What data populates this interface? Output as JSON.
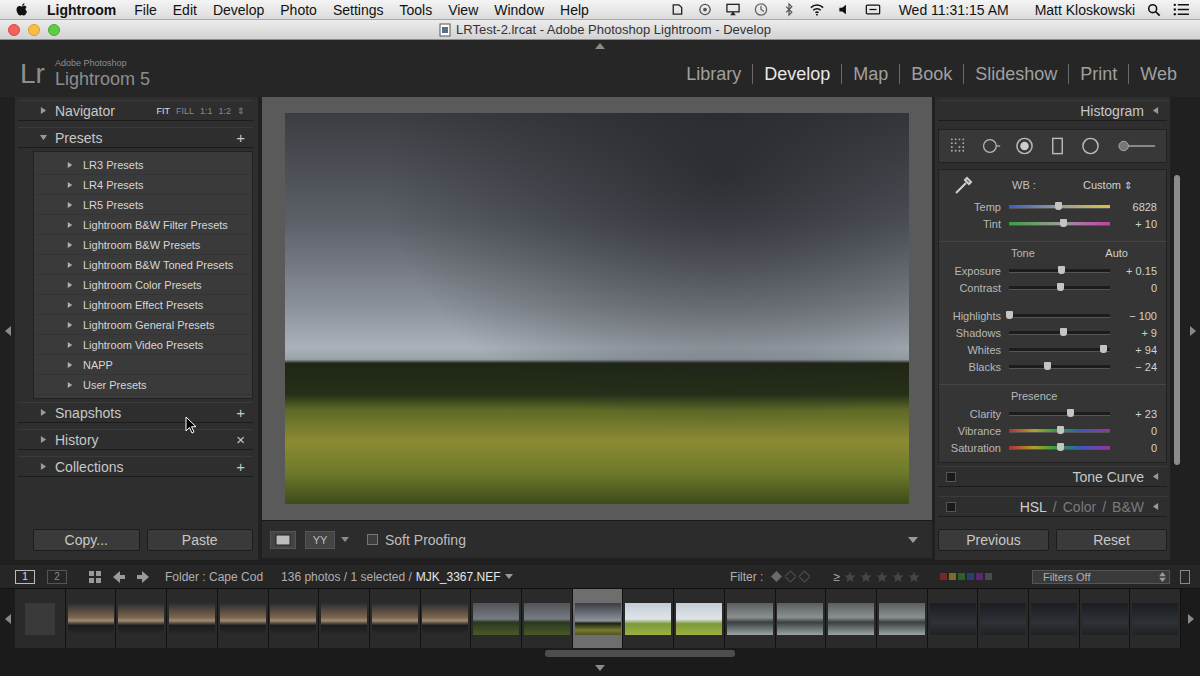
{
  "menubar": {
    "app": "Lightroom",
    "items": [
      "File",
      "Edit",
      "Develop",
      "Photo",
      "Settings",
      "Tools",
      "View",
      "Window",
      "Help"
    ],
    "clock": "Wed 11:31:15 AM",
    "user": "Matt Kloskowski"
  },
  "window": {
    "title": "LRTest-2.lrcat - Adobe Photoshop Lightroom - Develop"
  },
  "logo": {
    "mark": "Lr",
    "vendor": "Adobe Photoshop",
    "product": "Lightroom 5"
  },
  "modules": [
    {
      "label": "Library",
      "selected": false
    },
    {
      "label": "Develop",
      "selected": true
    },
    {
      "label": "Map",
      "selected": false
    },
    {
      "label": "Book",
      "selected": false
    },
    {
      "label": "Slideshow",
      "selected": false
    },
    {
      "label": "Print",
      "selected": false
    },
    {
      "label": "Web",
      "selected": false
    }
  ],
  "left_panel": {
    "navigator": {
      "title": "Navigator",
      "expanded": false,
      "zoom": [
        {
          "label": "FIT",
          "selected": true
        },
        {
          "label": "FILL",
          "selected": false
        },
        {
          "label": "1:1",
          "selected": false
        },
        {
          "label": "1:2",
          "selected": false
        }
      ],
      "zoom_arrow": "⇕"
    },
    "presets": {
      "title": "Presets",
      "expanded": true,
      "action": "+",
      "items": [
        {
          "label": "LR3 Presets",
          "expanded": false
        },
        {
          "label": "LR4 Presets",
          "expanded": false
        },
        {
          "label": "LR5 Presets",
          "expanded": false
        },
        {
          "label": "Lightroom B&W Filter Presets",
          "expanded": false
        },
        {
          "label": "Lightroom B&W Presets",
          "expanded": false
        },
        {
          "label": "Lightroom B&W Toned Presets",
          "expanded": false
        },
        {
          "label": "Lightroom Color Presets",
          "expanded": false
        },
        {
          "label": "Lightroom Effect Presets",
          "expanded": false
        },
        {
          "label": "Lightroom General Presets",
          "expanded": false
        },
        {
          "label": "Lightroom Video Presets",
          "expanded": false
        },
        {
          "label": "NAPP",
          "expanded": false
        },
        {
          "label": "User Presets",
          "expanded": false
        }
      ]
    },
    "sections": [
      {
        "title": "Snapshots",
        "expanded": false,
        "action": "+"
      },
      {
        "title": "History",
        "expanded": false,
        "action": "×"
      },
      {
        "title": "Collections",
        "expanded": false,
        "action": "+"
      }
    ],
    "buttons": [
      "Copy...",
      "Paste"
    ]
  },
  "center": {
    "toolbar": {
      "before_after": "YY",
      "soft_proofing": {
        "label": "Soft Proofing",
        "checked": false
      }
    }
  },
  "right_panel": {
    "histogram": {
      "title": "Histogram",
      "expanded": false
    },
    "basic": {
      "wb_label": "WB :",
      "wb_value": "Custom",
      "wb_arrow": "⇕",
      "wb_sliders": [
        {
          "label": "Temp",
          "reading": "6828",
          "level": 0.49,
          "kind": "temp"
        },
        {
          "label": "Tint",
          "reading": "+ 10",
          "level": 0.53,
          "kind": "tint"
        }
      ],
      "groups": [
        {
          "title": "Tone",
          "action": "Auto",
          "sliders": [
            {
              "label": "Exposure",
              "reading": "+ 0.15",
              "level": 0.51,
              "kind": "plain"
            },
            {
              "label": "Contrast",
              "reading": "0",
              "level": 0.5,
              "kind": "plain"
            },
            {
              "label": "Highlights",
              "reading": "− 100",
              "level": 0.0,
              "kind": "plain"
            },
            {
              "label": "Shadows",
              "reading": "+ 9",
              "level": 0.53,
              "kind": "plain"
            },
            {
              "label": "Whites",
              "reading": "+ 94",
              "level": 0.93,
              "kind": "plain"
            },
            {
              "label": "Blacks",
              "reading": "− 24",
              "level": 0.38,
              "kind": "plain"
            }
          ]
        },
        {
          "title": "Presence",
          "action": "",
          "sliders": [
            {
              "label": "Clarity",
              "reading": "+ 23",
              "level": 0.6,
              "kind": "plain"
            },
            {
              "label": "Vibrance",
              "reading": "0",
              "level": 0.5,
              "kind": "sat"
            },
            {
              "label": "Saturation",
              "reading": "0",
              "level": 0.5,
              "kind": "sat"
            }
          ]
        }
      ]
    },
    "tone_curve": {
      "title": "Tone Curve",
      "expanded": false
    },
    "hsl_tabs": {
      "items": [
        {
          "label": "HSL",
          "selected": true
        },
        {
          "label": "Color",
          "selected": false
        },
        {
          "label": "B&W",
          "selected": false
        }
      ],
      "separator": "/",
      "expanded": false
    },
    "buttons": [
      "Previous",
      "Reset"
    ]
  },
  "filmstrip": {
    "views": [
      {
        "label": "1",
        "selected": true
      },
      {
        "label": "2",
        "selected": false
      }
    ],
    "folder": "Folder : Cape Cod",
    "count": "136 photos / 1 selected /",
    "file": "MJK_3367.NEF",
    "filter_label": "Filter :",
    "rating_op": "≥",
    "stars": 0,
    "color_labels": [
      {
        "color": "#7a2626"
      },
      {
        "color": "#7a6e22"
      },
      {
        "color": "#2f5e26"
      },
      {
        "color": "#263f78"
      },
      {
        "color": "#5e2670"
      },
      {
        "color": "#4a4a4a"
      }
    ],
    "filter_preset": "Filters Off",
    "thumbs": [
      {
        "selected": false
      },
      {
        "selected": false
      },
      {
        "selected": false
      },
      {
        "selected": false
      },
      {
        "selected": false
      },
      {
        "selected": false
      },
      {
        "selected": false
      },
      {
        "selected": false
      },
      {
        "selected": false
      },
      {
        "selected": false
      },
      {
        "selected": false
      },
      {
        "selected": true
      },
      {
        "selected": false
      },
      {
        "selected": false
      },
      {
        "selected": false
      },
      {
        "selected": false
      },
      {
        "selected": false
      },
      {
        "selected": false
      },
      {
        "selected": false
      },
      {
        "selected": false
      },
      {
        "selected": false
      },
      {
        "selected": false
      },
      {
        "selected": false
      }
    ]
  }
}
